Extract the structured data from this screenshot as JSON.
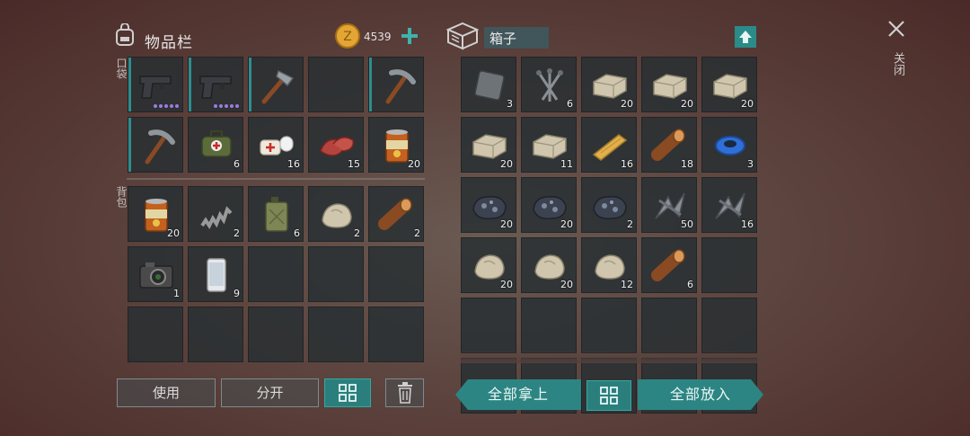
{
  "inventory": {
    "title": "物品栏",
    "coins": "4539",
    "pocket_label": "口袋",
    "backpack_label": "背包",
    "pocket": [
      {
        "icon": "pistol-icon",
        "qty": "",
        "dots": true,
        "accent": true
      },
      {
        "icon": "pistol-icon",
        "qty": "",
        "dots": true,
        "accent": true
      },
      {
        "icon": "hatchet-icon",
        "qty": "",
        "accent": true
      },
      {
        "icon": "",
        "qty": ""
      },
      {
        "icon": "pickaxe-icon",
        "qty": "",
        "accent": true
      },
      {
        "icon": "pickaxe-icon",
        "qty": "",
        "accent": true
      },
      {
        "icon": "medkit-bag-icon",
        "qty": "6"
      },
      {
        "icon": "bandage-icon",
        "qty": "16"
      },
      {
        "icon": "raw-meat-icon",
        "qty": "15"
      },
      {
        "icon": "canned-food-icon",
        "qty": "20"
      }
    ],
    "backpack": [
      {
        "icon": "canned-food-icon",
        "qty": "20"
      },
      {
        "icon": "spring-icon",
        "qty": "2"
      },
      {
        "icon": "jerrycan-icon",
        "qty": "6"
      },
      {
        "icon": "stone-icon",
        "qty": "2"
      },
      {
        "icon": "log-icon",
        "qty": "2"
      },
      {
        "icon": "camera-icon",
        "qty": "1"
      },
      {
        "icon": "smartphone-icon",
        "qty": "9"
      },
      {
        "icon": "",
        "qty": ""
      },
      {
        "icon": "",
        "qty": ""
      },
      {
        "icon": "",
        "qty": ""
      },
      {
        "icon": "",
        "qty": ""
      },
      {
        "icon": "",
        "qty": ""
      },
      {
        "icon": "",
        "qty": ""
      },
      {
        "icon": "",
        "qty": ""
      },
      {
        "icon": "",
        "qty": ""
      }
    ],
    "buttons": {
      "use": "使用",
      "split": "分开"
    }
  },
  "box": {
    "title": "箱子",
    "items": [
      {
        "icon": "metal-plate-icon",
        "qty": "3"
      },
      {
        "icon": "nails-icon",
        "qty": "6"
      },
      {
        "icon": "stone-block-icon",
        "qty": "20"
      },
      {
        "icon": "stone-block-icon",
        "qty": "20"
      },
      {
        "icon": "stone-block-icon",
        "qty": "20"
      },
      {
        "icon": "stone-block-icon",
        "qty": "20"
      },
      {
        "icon": "stone-block-icon",
        "qty": "11"
      },
      {
        "icon": "plank-icon",
        "qty": "16"
      },
      {
        "icon": "log-icon",
        "qty": "18"
      },
      {
        "icon": "duct-tape-icon",
        "qty": "3"
      },
      {
        "icon": "iron-ore-icon",
        "qty": "20"
      },
      {
        "icon": "iron-ore-icon",
        "qty": "20"
      },
      {
        "icon": "iron-ore-icon",
        "qty": "2"
      },
      {
        "icon": "scrap-metal-icon",
        "qty": "50"
      },
      {
        "icon": "scrap-metal-icon",
        "qty": "16"
      },
      {
        "icon": "stone-icon",
        "qty": "20"
      },
      {
        "icon": "stone-icon",
        "qty": "20"
      },
      {
        "icon": "stone-icon",
        "qty": "12"
      },
      {
        "icon": "log-icon",
        "qty": "6"
      },
      {
        "icon": "",
        "qty": ""
      },
      {
        "icon": "",
        "qty": ""
      },
      {
        "icon": "",
        "qty": ""
      },
      {
        "icon": "",
        "qty": ""
      },
      {
        "icon": "",
        "qty": ""
      },
      {
        "icon": "",
        "qty": ""
      },
      {
        "icon": "",
        "qty": ""
      },
      {
        "icon": "",
        "qty": ""
      },
      {
        "icon": "",
        "qty": ""
      },
      {
        "icon": "",
        "qty": ""
      },
      {
        "icon": "",
        "qty": ""
      }
    ],
    "buttons": {
      "take_all": "全部拿上",
      "put_all": "全部放入"
    }
  },
  "close_label": "关闭",
  "colors": {
    "accent": "#2f8d8d",
    "slot": "#262e32",
    "teal_button": "#2a7f7d",
    "coin": "#e3a634"
  }
}
